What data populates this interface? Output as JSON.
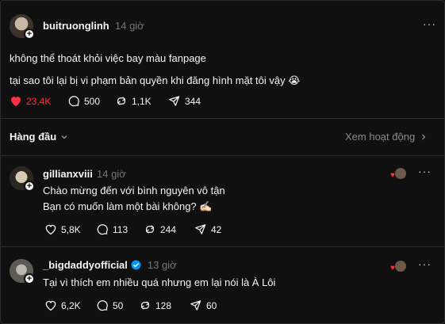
{
  "main_post": {
    "username": "buitruonglinh",
    "time": "14 giờ",
    "line1": "không thể thoát khỏi việc bay màu fanpage",
    "line2": "tại sao tôi lại bị vi phạm bản quyền khi đăng hình mặt tôi vậy",
    "emoji": "😭",
    "likes": "23,4K",
    "comments": "500",
    "reposts": "1,1K",
    "shares": "344",
    "liked_color": "#ff3040"
  },
  "header": {
    "sort_label": "Hàng đầu",
    "activity_link": "Xem hoạt động"
  },
  "replies": [
    {
      "username": "gillianxviii",
      "time": "14 giờ",
      "line1": "Chào mừng đến với bình nguyên vô tận",
      "line2": "Bạn có muốn làm một bài không? ✍🏻",
      "likes": "5,8K",
      "comments": "113",
      "reposts": "244",
      "shares": "42"
    },
    {
      "username": "_bigdaddyofficial",
      "time": "13 giờ",
      "verified": true,
      "line1": "Tại vì thích em nhiều quá nhưng em lại nói là À Lôi",
      "likes": "6,2K",
      "comments": "50",
      "reposts": "128",
      "shares": "60"
    }
  ],
  "icons": {
    "more": "more-icon",
    "heart": "heart-icon",
    "comment": "comment-icon",
    "repost": "repost-icon",
    "share": "share-icon"
  }
}
